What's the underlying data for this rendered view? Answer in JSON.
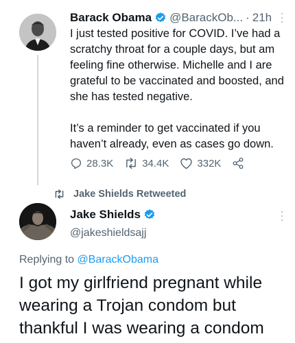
{
  "tweet": {
    "author_name": "Barack Obama",
    "author_handle": "@BarackOb...",
    "separator": "·",
    "time": "21h",
    "paragraph1": "I just tested positive for COVID. I’ve had a scratchy throat for a couple days, but am feeling fine otherwise. Michelle and I are grateful to be vaccinated and boosted, and she has tested negative.",
    "paragraph2": "It’s a reminder to get vaccinated if you haven’t already, even as cases go down.",
    "replies": "28.3K",
    "retweets": "34.4K",
    "likes": "332K"
  },
  "retweet_context": {
    "label": "Jake Shields Retweeted"
  },
  "reply_tweet": {
    "author_name": "Jake Shields",
    "author_handle": "@jakeshieldsajj",
    "replying_prefix": "Replying to",
    "replying_to": "@BarackObama",
    "text": "I got my girlfriend pregnant while wearing a Trojan condom but thankful I was wearing a condom"
  },
  "colors": {
    "verified": "#1d9bf0",
    "muted": "#536471",
    "link": "#1d9bf0",
    "text": "#0f1419"
  },
  "icons": {
    "verified": "verified-badge-icon",
    "reply": "reply-icon",
    "retweet": "retweet-icon",
    "like": "heart-icon",
    "share": "share-icon",
    "more": "more-options-icon"
  }
}
